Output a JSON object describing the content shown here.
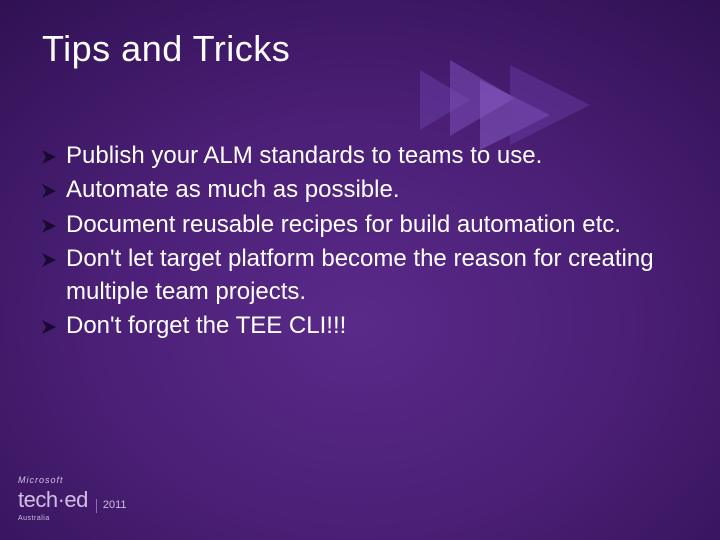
{
  "title": "Tips and Tricks",
  "bullets": [
    "Publish your ALM standards to teams to use.",
    "Automate as much as possible.",
    "Document reusable recipes for build automation etc.",
    "Don't let target platform become the reason for creating multiple team projects.",
    "Don't forget the TEE CLI!!!"
  ],
  "branding": {
    "company": "Microsoft",
    "product": "tech·ed",
    "region": "Australia",
    "year": "2011"
  },
  "colors": {
    "background_center": "#5a2a8a",
    "background_edge": "#120528",
    "text": "#ffffff",
    "bullet_arrow": "#1a0a33",
    "decor_triangle": "#7a4fb8"
  }
}
